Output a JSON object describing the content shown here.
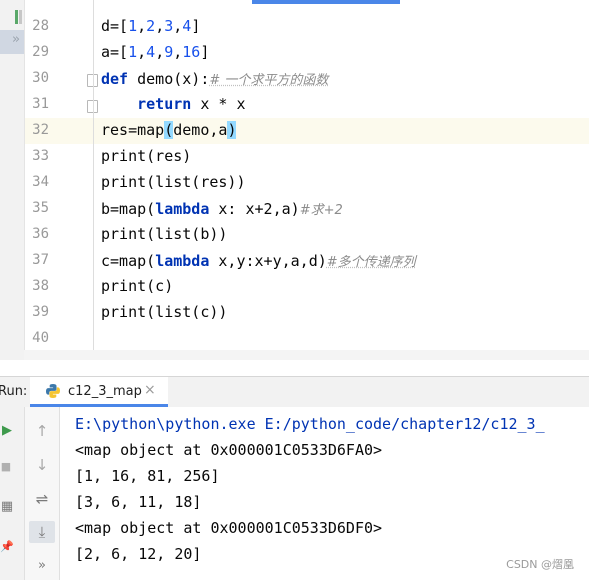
{
  "editor": {
    "lines": [
      {
        "num": "28",
        "text": "d=[1,2,3,4]"
      },
      {
        "num": "29",
        "text": "a=[1,4,9,16]"
      },
      {
        "num": "30",
        "text_def": "def",
        "text_sig": " demo(x):",
        "comment": "# 一个求平方的函数"
      },
      {
        "num": "31",
        "text_ret": "return",
        "text_expr": " x * x"
      },
      {
        "num": "32",
        "text_pre": "res=map",
        "text_p1": "(",
        "text_mid": "demo,a",
        "text_p2": ")"
      },
      {
        "num": "33",
        "text": "print(res)"
      },
      {
        "num": "34",
        "text": "print(list(res))"
      },
      {
        "num": "35",
        "text_pre": "b=map(",
        "text_kw": "lambda",
        "text_rest": " x: x+2,a)",
        "comment": "#求+2"
      },
      {
        "num": "36",
        "text": "print(list(b))"
      },
      {
        "num": "37",
        "text_pre": "c=map(",
        "text_kw": "lambda",
        "text_rest": " x,y:x+y,a,d)",
        "comment": "#多个传递序列"
      },
      {
        "num": "38",
        "text": "print(c)"
      },
      {
        "num": "39",
        "text": "print(list(c))"
      },
      {
        "num": "40",
        "text": ""
      }
    ]
  },
  "run_panel": {
    "label": "Run:",
    "tab_label": "c12_3_map",
    "close_glyph": "×",
    "output": [
      "E:\\python\\python.exe E:/python_code/chapter12/c12_3_",
      "<map object at 0x000001C0533D6FA0>",
      "[1, 16, 81, 256]",
      "[3, 6, 11, 18]",
      "<map object at 0x000001C0533D6DF0>",
      "[2, 6, 12, 20]"
    ]
  },
  "watermark": "CSDN @熠凰",
  "icons": {
    "up": "↑",
    "down": "↓",
    "wrap": "⇌",
    "scroll_end": "⤓",
    "more": "»",
    "run": "▶",
    "stop": "■",
    "layout": "▦",
    "pin": "📌"
  },
  "colors": {
    "accent": "#4a86e8",
    "keyword": "#0033b3",
    "number": "#1750eb",
    "comment": "#8c8c8c",
    "current_line": "#fcfaed"
  }
}
